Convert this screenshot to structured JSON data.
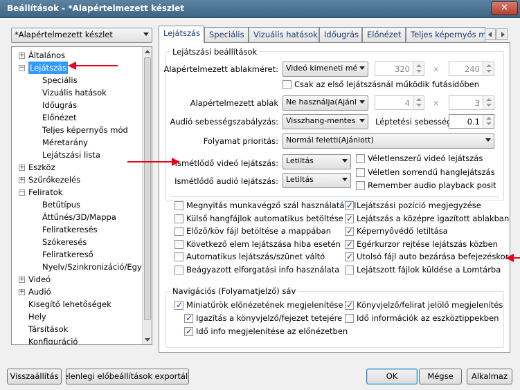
{
  "window": {
    "title": "Beállítások - *Alapértelmezett készlet",
    "close_label": "✕"
  },
  "preset": {
    "value": "*Alapértelmezett készlet"
  },
  "tree": {
    "items": [
      {
        "label": "Általános",
        "level": 0,
        "expander": "+"
      },
      {
        "label": "Lejátszás",
        "level": 0,
        "expander": "−",
        "selected": true
      },
      {
        "label": "Speciális",
        "level": 1
      },
      {
        "label": "Vizuális hatások",
        "level": 1
      },
      {
        "label": "Időugrás",
        "level": 1
      },
      {
        "label": "Előnézet",
        "level": 1
      },
      {
        "label": "Teljes képernyős mód",
        "level": 1
      },
      {
        "label": "Méretarány",
        "level": 1
      },
      {
        "label": "Lejátszási lista",
        "level": 1
      },
      {
        "label": "Eszköz",
        "level": 0,
        "expander": "+"
      },
      {
        "label": "Szűrőkezelés",
        "level": 0,
        "expander": "+"
      },
      {
        "label": "Feliratok",
        "level": 0,
        "expander": "−"
      },
      {
        "label": "Betűtípus",
        "level": 1
      },
      {
        "label": "Áttűnés/3D/Mappa",
        "level": 1
      },
      {
        "label": "Feliratkeresés",
        "level": 1
      },
      {
        "label": "Szókeresés",
        "level": 1
      },
      {
        "label": "Feliratkereső",
        "level": 1
      },
      {
        "label": "Nyelv/Szinkronizáció/Egyéb",
        "level": 1
      },
      {
        "label": "Videó",
        "level": 0,
        "expander": "+"
      },
      {
        "label": "Audió",
        "level": 0,
        "expander": "+"
      },
      {
        "label": "Kisegítő lehetőségek",
        "level": 0
      },
      {
        "label": "Hely",
        "level": 0
      },
      {
        "label": "Társítások",
        "level": 0
      },
      {
        "label": "Konfiguráció",
        "level": 0
      }
    ]
  },
  "tabs": [
    "Lejátszás",
    "Speciális",
    "Vizuális hatások",
    "Időugrás",
    "Előnézet",
    "Teljes képernyős mó"
  ],
  "playback": {
    "group_title": "Lejátszási beállítások",
    "window_size_label": "Alapértelmezett ablakméret:",
    "window_size_value": "Videó kimeneti mé",
    "size_w": "320",
    "size_h": "240",
    "times": "×",
    "first_play_only": "Csak az első lejátszásnál működik futásidőben",
    "default_window_label": "Alapértelmezett ablak",
    "default_window_value": "Ne használja(Ajánl",
    "num_a": "4",
    "num_b": "3",
    "audio_speed_label": "Audió sebességszabályzás:",
    "audio_speed_value": "Visszhang-mentes",
    "step_speed_label": "Léptetési sebesség:",
    "step_speed_value": "0.1",
    "priority_label": "Folyamat prioritás:",
    "priority_value": "Normál feletti(Ajánlott)",
    "repeat_video_label": "Ismétlődő videó lejátszás:",
    "repeat_video_value": "Letiltás",
    "repeat_audio_label": "Ismétlődő audió lejátszás:",
    "repeat_audio_value": "Letiltás",
    "random_video": "Véletlenszerű videó lejátszás",
    "random_audio": "Véletlen sorrendű hanglejátszás",
    "remember_audio": "Remember audio playback positior"
  },
  "checks_left": [
    {
      "label": "Megnyitás munkavégző szál használatával",
      "checked": false
    },
    {
      "label": "Külső hangfájlok automatikus betöltése",
      "checked": false
    },
    {
      "label": "Előző/köv fájl betöltése a mappában",
      "checked": false
    },
    {
      "label": "Következő elem lejátszása hiba esetén",
      "checked": false
    },
    {
      "label": "Automatikus lejátszás/szünet váltó",
      "checked": false
    },
    {
      "label": "Beágyazott elforgatási info használata",
      "checked": false
    }
  ],
  "checks_right": [
    {
      "label": "Lejátszási pozíció megjegyzése",
      "checked": true
    },
    {
      "label": "Lejátszás a középre igazított ablakban",
      "checked": true
    },
    {
      "label": "Képernyővédő letiltása",
      "checked": true
    },
    {
      "label": "Egérkurzor rejtése lejátszás közben",
      "checked": true
    },
    {
      "label": "Utolsó fájl auto bezárása befejezéskor",
      "checked": true
    },
    {
      "label": "Lejátszott fájlok küldése a Lomtárba",
      "checked": false
    }
  ],
  "nav": {
    "group_title": "Navigációs (Folyamatjelző) sáv",
    "thumbs": "Miniatűrök előnézetének megjelenítése",
    "align": "Igazítás a könyvjelző/fejezet tetejére",
    "timeinfo": "Idő info megjelenítése az előnézetben",
    "bookmark": "Könyvjelző/felirat jelölő megjelenítés",
    "toolbar_time": "Idő információk az eszköztippekben"
  },
  "buttons": {
    "reset": "Visszaállítás",
    "export": "Jelenlegi előbeállítások exportálása",
    "ok": "OK",
    "cancel": "Mégse",
    "apply": "Alkalmaz"
  },
  "colors": {
    "annotation_arrow": "#e8001c",
    "selection": "#3399ff"
  }
}
